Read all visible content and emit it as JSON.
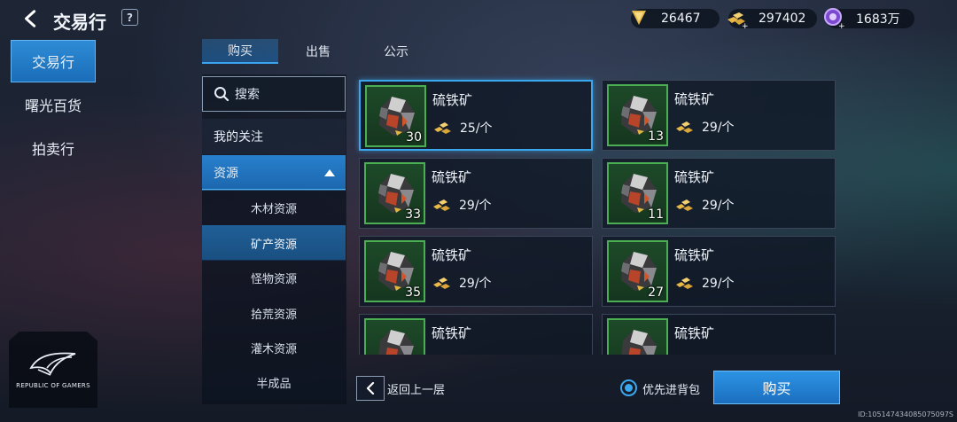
{
  "header": {
    "title": "交易行",
    "help_label": "?",
    "currencies": [
      {
        "icon": "ticket-icon",
        "value": "26467"
      },
      {
        "icon": "gold-bars-plus-icon",
        "value": "297402"
      },
      {
        "icon": "purple-coin-plus-icon",
        "value": "1683万"
      }
    ]
  },
  "sidebar": {
    "items": [
      {
        "label": "交易行",
        "active": true
      },
      {
        "label": "曙光百货",
        "active": false
      },
      {
        "label": "拍卖行",
        "active": false
      }
    ],
    "logo_text": "REPUBLIC OF GAMERS"
  },
  "tabs": [
    {
      "label": "购买",
      "active": true
    },
    {
      "label": "出售",
      "active": false
    },
    {
      "label": "公示",
      "active": false
    }
  ],
  "categories": {
    "search_placeholder": "搜索",
    "favorites": "我的关注",
    "resources": "资源",
    "sub_items": [
      "木材资源",
      "矿产资源",
      "怪物资源",
      "拾荒资源",
      "灌木资源",
      "半成品"
    ],
    "selected_sub": "矿产资源"
  },
  "items": [
    {
      "name": "硫铁矿",
      "qty": "30",
      "price": "25/个",
      "selected": true
    },
    {
      "name": "硫铁矿",
      "qty": "13",
      "price": "29/个",
      "selected": false
    },
    {
      "name": "硫铁矿",
      "qty": "33",
      "price": "29/个",
      "selected": false
    },
    {
      "name": "硫铁矿",
      "qty": "11",
      "price": "29/个",
      "selected": false
    },
    {
      "name": "硫铁矿",
      "qty": "35",
      "price": "29/个",
      "selected": false
    },
    {
      "name": "硫铁矿",
      "qty": "27",
      "price": "29/个",
      "selected": false
    },
    {
      "name": "硫铁矿",
      "qty": "",
      "price": "",
      "selected": false
    },
    {
      "name": "硫铁矿",
      "qty": "",
      "price": "",
      "selected": false
    }
  ],
  "footer": {
    "back_label": "返回上一层",
    "backpack_option": "优先进背包",
    "buy_label": "购买"
  },
  "watermark": "ID:105147434085075097S"
}
